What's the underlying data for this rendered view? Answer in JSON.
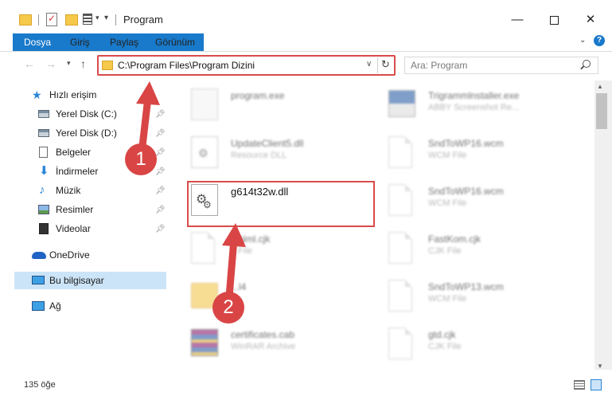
{
  "window": {
    "title": "Program"
  },
  "ribbon": {
    "tabs": [
      "Dosya",
      "Giriş",
      "Paylaş",
      "Görünüm"
    ]
  },
  "address": {
    "path": "C:\\Program Files\\Program Dizini"
  },
  "search": {
    "placeholder": "Ara: Program"
  },
  "nav_pane": {
    "items": [
      {
        "label": "Hızlı erişim",
        "icon": "star-icon"
      },
      {
        "label": "Yerel Disk (C:)",
        "icon": "disk-icon",
        "pinned": true
      },
      {
        "label": "Yerel Disk (D:)",
        "icon": "disk-icon",
        "pinned": true
      },
      {
        "label": "Belgeler",
        "icon": "documents-icon",
        "pinned": true
      },
      {
        "label": "İndirmeler",
        "icon": "downloads-icon",
        "pinned": true
      },
      {
        "label": "Müzik",
        "icon": "music-icon",
        "pinned": true
      },
      {
        "label": "Resimler",
        "icon": "pictures-icon",
        "pinned": true
      },
      {
        "label": "Videolar",
        "icon": "videos-icon",
        "pinned": true
      },
      {
        "label": "OneDrive",
        "icon": "cloud-icon"
      },
      {
        "label": "Bu bilgisayar",
        "icon": "computer-icon",
        "selected": true
      },
      {
        "label": "Ağ",
        "icon": "network-icon"
      }
    ]
  },
  "files": [
    {
      "name": "program.exe",
      "type": "",
      "icon": "exe-icon"
    },
    {
      "name": "Trigrammlnstaller.exe",
      "type": "ABBY Screenshot Re...",
      "icon": "installer-icon"
    },
    {
      "name": "UpdateClient5.dll",
      "type": "Resource DLL",
      "icon": "dll-icon"
    },
    {
      "name": "SndToWP16.wcm",
      "type": "WCM File",
      "icon": "document-icon"
    },
    {
      "name": "g614t32w.dll",
      "type": "",
      "icon": "dll-icon",
      "highlighted": true
    },
    {
      "name": "SndToWP16.wcm",
      "type": "WCM File",
      "icon": "document-icon"
    },
    {
      "name": "...Nml.cjk",
      "type": "...File",
      "icon": "document-icon"
    },
    {
      "name": "FastKom.cjk",
      "type": "CJK File",
      "icon": "document-icon"
    },
    {
      "name": "...l4",
      "type": "",
      "icon": "folder-icon"
    },
    {
      "name": "SndToWP13.wcm",
      "type": "WCM File",
      "icon": "document-icon"
    },
    {
      "name": "certificates.cab",
      "type": "WinRAR Archive",
      "icon": "archive-icon"
    },
    {
      "name": "gtd.cjk",
      "type": "CJK File",
      "icon": "document-icon"
    }
  ],
  "annotations": {
    "step1": "1",
    "step2": "2",
    "color": "#d94545"
  },
  "status": {
    "count": "135 öğe"
  },
  "colors": {
    "accent": "#1979ca",
    "highlight": "#d94b4b",
    "selection": "#cce4f7"
  }
}
